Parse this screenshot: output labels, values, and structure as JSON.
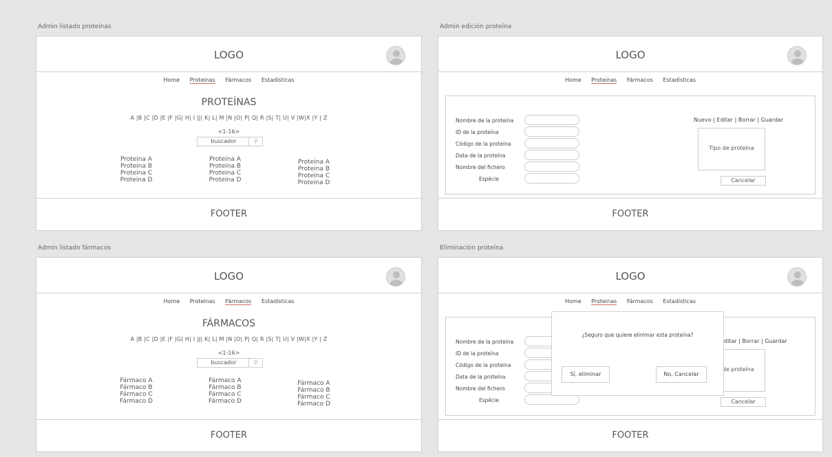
{
  "colors": {
    "background": "#e6e6e6",
    "frame": "#ffffff",
    "border": "#cfcfcf",
    "nav_active_underline": "#c96b6b"
  },
  "panels": {
    "list_proteins": {
      "title": "Admin listado proteinas",
      "logo": "LOGO",
      "nav": [
        "Home",
        "Proteinas",
        "Fármacos",
        "Estadísticas"
      ],
      "heading": "PROTEÍNAS",
      "alphabet": "A |B |C |D |E |F |G| H| I |J| K| L| M |N |O| P| Q| R |S| T| U| V |W|X |Y | Z",
      "pager": "<1-16>",
      "search_placeholder": "buscador",
      "columns": [
        [
          "Proteina A",
          "Proteina B",
          "Proteina C",
          "Proteina D"
        ],
        [
          "Proteina A",
          "Proteina B",
          "Proteina C",
          "Proteina D"
        ],
        [
          "Proteina A",
          "Proteina B",
          "Proteina C",
          "Proteina D"
        ]
      ],
      "footer": "FOOTER"
    },
    "edit_protein": {
      "title": "Admin edición proteína",
      "logo": "LOGO",
      "nav": [
        "Home",
        "Proteinas",
        "Fármacos",
        "Estadísticas"
      ],
      "fields": [
        "Nombre de la proteína",
        "ID de la proteína",
        "Código de la proteína",
        "Data de la proteína",
        "Nombre del fichero",
        "Espécie"
      ],
      "actions": "Nuevo | Editar | Borrar | Guardar",
      "type_box": "Tipo de proteína",
      "cancel": "Cancelar",
      "footer": "FOOTER"
    },
    "list_drugs": {
      "title": "Admin listado fármacos",
      "logo": "LOGO",
      "nav": [
        "Home",
        "Proteinas",
        "Fármacos",
        "Estadísticas"
      ],
      "heading": "FÁRMACOS",
      "alphabet": "A |B |C |D |E |F |G| H| I |J| K| L| M |N |O| P| Q| R |S| T| U| V |W|X |Y | Z",
      "pager": "<1-16>",
      "search_placeholder": "buscador",
      "columns": [
        [
          "Fármaco A",
          "Fármaco B",
          "Fármaco C",
          "Fármaco D"
        ],
        [
          "Fármaco A",
          "Fármaco B",
          "Fármaco C",
          "Fármaco D"
        ],
        [
          "Fármaco A",
          "Fármaco B",
          "Fármaco C",
          "Fármaco D"
        ]
      ],
      "footer": "FOOTER"
    },
    "delete_protein": {
      "title": "Eliminación proteína",
      "logo": "LOGO",
      "nav": [
        "Home",
        "Proteinas",
        "Fármacos",
        "Estadísticas"
      ],
      "fields": [
        "Nombre de la proteína",
        "ID de la proteína",
        "Código de la proteína",
        "Data de la proteína",
        "Nombre del fichero",
        "Espécie"
      ],
      "actions": "ditar | Borrar | Guardar",
      "type_box": "Tipo de proteína",
      "cancel": "Cancelar",
      "modal_question": "¿Seguro que quiere eliminar esta proteína?",
      "modal_yes": "Sí, eliminar",
      "modal_no": "No, Cancelar",
      "footer": "FOOTER"
    }
  }
}
